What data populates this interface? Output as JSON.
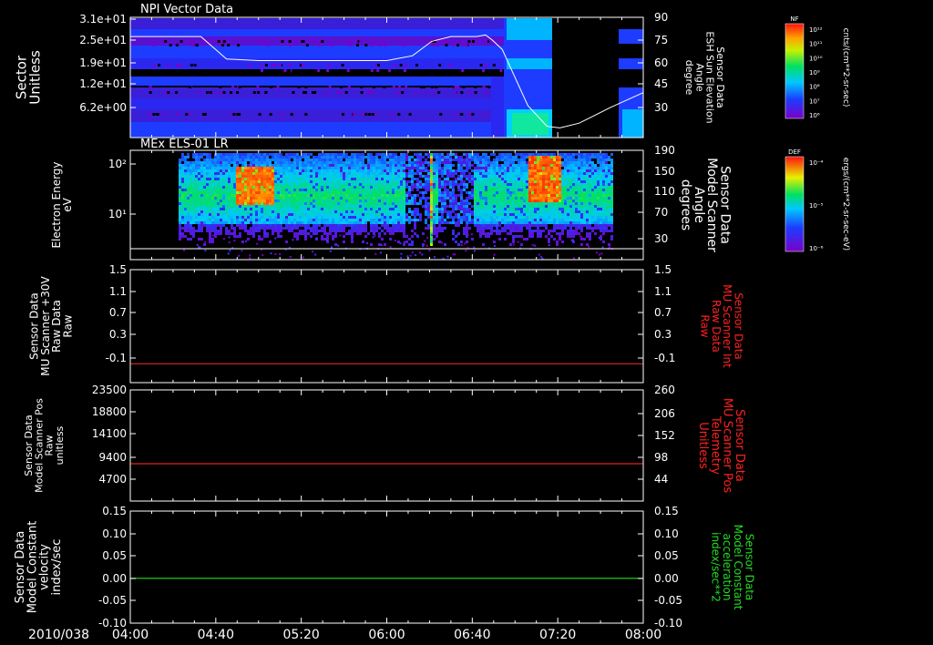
{
  "chart_data": [
    {
      "type": "heatmap",
      "title": "NPI Vector Data",
      "ylabel": "Sector\nUnitless",
      "yticks": [
        "3.1e+01",
        "2.5e+01",
        "1.9e+01",
        "1.2e+01",
        "6.2e+00"
      ],
      "y2label": "Sensor Data\nESH Sun Elevation\nAngle\ndegree",
      "y2ticks": [
        "90",
        "75",
        "60",
        "45",
        "30"
      ],
      "colorbar": {
        "label": "NF",
        "unit": "cnts/(cm**2-sr-sec)",
        "ticks": [
          "10¹²",
          "10¹¹",
          "10¹⁰",
          "10⁹",
          "10⁸",
          "10⁷",
          "10⁶"
        ]
      },
      "sun_elevation_series": {
        "hours": [
          4.0,
          4.3,
          4.55,
          4.75,
          5.0,
          5.5,
          6.0,
          6.2,
          6.35,
          6.5,
          6.7,
          6.77,
          6.82,
          6.9,
          7.1,
          7.25,
          7.35,
          7.5,
          7.75,
          8.0
        ],
        "deg": [
          78,
          78,
          78,
          64,
          63,
          63,
          63,
          66,
          75,
          78,
          78,
          79,
          76,
          70,
          35,
          22,
          21,
          24,
          34,
          43
        ]
      }
    },
    {
      "type": "heatmap",
      "title": "MEx ELS-01 LR",
      "ylabel": "Electron Energy\neV",
      "yticks": [
        "10²",
        "10¹"
      ],
      "y2label": "Sensor Data\nModel Scanner\nAngle\ndegrees",
      "y2ticks": [
        "190",
        "150",
        "110",
        "70",
        "30"
      ],
      "colorbar": {
        "label": "DEF",
        "unit": "ergs/(cm**2-sr-sec-eV)",
        "ticks": [
          "10⁻⁴",
          "10⁻⁵",
          "10⁻⁶"
        ]
      }
    },
    {
      "type": "line",
      "ylabel": "Sensor Data\nMU Scanner +30V\nRaw Data\nRaw",
      "yticks": [
        "1.5",
        "1.1",
        "0.7",
        "0.3",
        "-0.1"
      ],
      "y2label": "Sensor Data\nMU Scanner Int\nRaw Data\nRaw",
      "y2ticks": [
        "1.5",
        "1.1",
        "0.7",
        "0.3",
        "-0.1"
      ],
      "ylim": [
        -0.3,
        1.5
      ],
      "series": [
        {
          "name": "Sensor Data MU Scanner Int Raw Data",
          "color": "#e02020",
          "value": 0.0
        }
      ]
    },
    {
      "type": "line",
      "ylabel": "Sensor Data\nModel Scanner Pos\nRaw\nunitless",
      "yticks": [
        "23500",
        "18800",
        "14100",
        "9400",
        "4700"
      ],
      "y2label": "Sensor Data\nMU Scanner Pos\nTelemetry\nUnitless",
      "y2ticks": [
        "260",
        "206",
        "152",
        "98",
        "44"
      ],
      "ylim": [
        0,
        23500
      ],
      "series": [
        {
          "name": "Sensor Data MU Scanner Pos Telemetry",
          "color": "#e02020",
          "value": 7900
        }
      ]
    },
    {
      "type": "line",
      "ylabel": "Sensor Data\nModel Constant\nvelocity\nindex/sec",
      "yticks": [
        "0.15",
        "0.10",
        "0.05",
        "0.00",
        "-0.05",
        "-0.10"
      ],
      "y2label": "Sensor Data\nModel Constant\nacceleration\nindex/sec**2",
      "y2ticks": [
        "0.15",
        "0.10",
        "0.05",
        "0.00",
        "-0.05",
        "-0.10"
      ],
      "ylim": [
        -0.1,
        0.15
      ],
      "series": [
        {
          "name": "Sensor Data Model Constant acceleration",
          "color": "#22dd22",
          "value": 0.0
        }
      ]
    }
  ],
  "xaxis": {
    "date": "2010/038",
    "ticks": [
      "04:00",
      "04:40",
      "05:20",
      "06:00",
      "06:40",
      "07:20",
      "08:00"
    ]
  },
  "colors": {
    "red_label": "#ff2020",
    "green_label": "#22dd22",
    "axis": "#ffffff"
  }
}
